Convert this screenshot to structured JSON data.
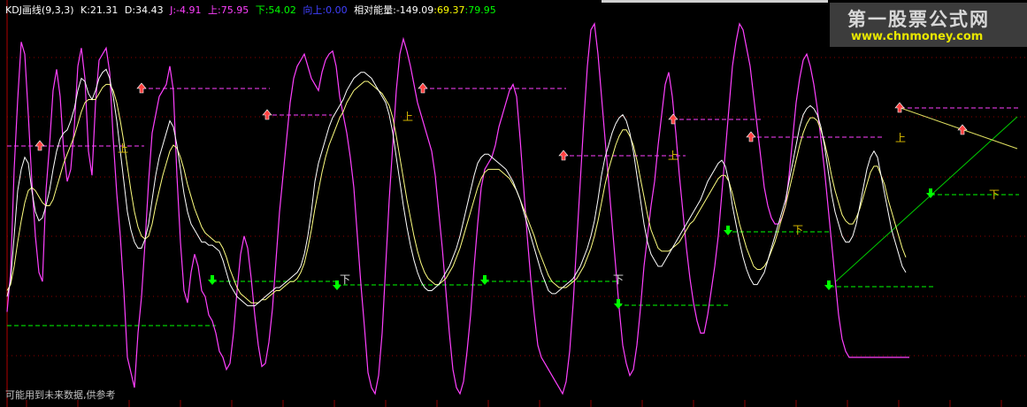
{
  "header": {
    "indicator": "KDJ画线(9,3,3)",
    "k": "K:21.31",
    "d": "D:34.43",
    "j": "J:-4.91",
    "up": "上:75.95",
    "down": "下:54.02",
    "upward": "向上:0.00",
    "energy": "相对能量:-149.09",
    "e2": ":69.37",
    "e3": ":79.95"
  },
  "footer_note": "可能用到未来数据,供参考",
  "watermark": {
    "cn": "第一股票公式网",
    "url": "www.chnmoney.com"
  },
  "colors": {
    "k": "#ffffff",
    "d": "#ffff80",
    "j": "#ff40ff",
    "up_marker": "#ff4040",
    "down_marker": "#00ff00",
    "up_line": "#ff40ff",
    "down_line": "#00ff00",
    "header_k": "#ffffff",
    "header_j": "#ff40ff",
    "header_up": "#ff40ff",
    "header_down": "#00ff00",
    "header_upward": "#4040ff",
    "header_energy": "#ffffff",
    "header_e2": "#ffff00",
    "header_e3": "#00ff00"
  },
  "chart_data": {
    "type": "line",
    "ylim": [
      -12,
      112
    ],
    "x": [
      0,
      4,
      8,
      12,
      16,
      20,
      24,
      28,
      32,
      36,
      40,
      44,
      48,
      52,
      56,
      60,
      64,
      68,
      72,
      76,
      80,
      84,
      88,
      92,
      96,
      100,
      104,
      108,
      112,
      116,
      120,
      124,
      128,
      132,
      136,
      140,
      144,
      148,
      152,
      156,
      160,
      164,
      168,
      172,
      176,
      180,
      184,
      188,
      192,
      196,
      200,
      204,
      208,
      212,
      216,
      220,
      224,
      228,
      232,
      236,
      240,
      244,
      248,
      252,
      256,
      260,
      264,
      268,
      272,
      276,
      280,
      284,
      288,
      292,
      296,
      300,
      304,
      308,
      312,
      316,
      320,
      324,
      328,
      332,
      336,
      340,
      344,
      348,
      352,
      356,
      360,
      364,
      368,
      372,
      376,
      380,
      384,
      388,
      392,
      396,
      400,
      404,
      408,
      412,
      416,
      420,
      424,
      428,
      432,
      436,
      440,
      444,
      448,
      452,
      456,
      460,
      464,
      468,
      472,
      476,
      480,
      484,
      488,
      492,
      496,
      500,
      504,
      508,
      512,
      516,
      520,
      524,
      528,
      532,
      536,
      540,
      544,
      548,
      552,
      556,
      560,
      564,
      568,
      572,
      576,
      580,
      584,
      588,
      592,
      596,
      600,
      604,
      608,
      612,
      616,
      620,
      624,
      628,
      632,
      636,
      640,
      644,
      648,
      652,
      656,
      660,
      664,
      668,
      672,
      676,
      680,
      684,
      688,
      692,
      696,
      700,
      704,
      708,
      712,
      716,
      720,
      724,
      728,
      732,
      736,
      740,
      744,
      748,
      752,
      756,
      760,
      764,
      768,
      772,
      776,
      780,
      784,
      788,
      792,
      796,
      800,
      804,
      808,
      812,
      816,
      820,
      824,
      828,
      832,
      836,
      840,
      844,
      848,
      852,
      856,
      860,
      864,
      868,
      872,
      876,
      880,
      884,
      888,
      892,
      896,
      900,
      904,
      908,
      912,
      916,
      920,
      924,
      928,
      932,
      936,
      940,
      944,
      948,
      952,
      956,
      960,
      964,
      968,
      972,
      976,
      980,
      984,
      988,
      992,
      996,
      1000,
      1004,
      1008,
      1012,
      1016,
      1020,
      1024,
      1028,
      1032,
      1036,
      1040,
      1044,
      1048,
      1052,
      1056,
      1060,
      1064,
      1068,
      1072,
      1076,
      1080,
      1084,
      1088,
      1092,
      1096,
      1100,
      1104,
      1108,
      1112,
      1116,
      1120,
      1124,
      1128,
      1132,
      1136,
      1140,
      1144,
      1148
    ],
    "series": [
      {
        "key": "k",
        "values": [
          20,
          25,
          40,
          55,
          62,
          66,
          64,
          55,
          48,
          45,
          46,
          50,
          55,
          62,
          68,
          72,
          74,
          75,
          78,
          82,
          88,
          92,
          91,
          87,
          85,
          88,
          92,
          94,
          95,
          92,
          86,
          78,
          68,
          58,
          48,
          42,
          38,
          36,
          36,
          39,
          44,
          52,
          60,
          66,
          70,
          74,
          78,
          76,
          70,
          62,
          54,
          48,
          44,
          42,
          40,
          38,
          38,
          37,
          37,
          36,
          35,
          32,
          28,
          24,
          22,
          20,
          19,
          18,
          17,
          17,
          17,
          18,
          19,
          20,
          21,
          22,
          23,
          23,
          24,
          25,
          26,
          27,
          28,
          30,
          34,
          40,
          48,
          58,
          64,
          68,
          72,
          76,
          79,
          81,
          83,
          85,
          88,
          90,
          92,
          93,
          94,
          94,
          93,
          92,
          90,
          88,
          86,
          84,
          80,
          74,
          66,
          58,
          50,
          43,
          37,
          32,
          28,
          25,
          23,
          22,
          22,
          23,
          24,
          26,
          28,
          30,
          33,
          36,
          40,
          45,
          50,
          55,
          60,
          64,
          66,
          67,
          67,
          66,
          65,
          64,
          63,
          62,
          60,
          58,
          55,
          52,
          48,
          44,
          40,
          36,
          32,
          28,
          25,
          22,
          21,
          21,
          22,
          23,
          24,
          25,
          26,
          28,
          30,
          33,
          36,
          40,
          45,
          52,
          60,
          66,
          70,
          74,
          77,
          79,
          80,
          78,
          74,
          68,
          60,
          52,
          44,
          38,
          34,
          32,
          30,
          30,
          32,
          34,
          36,
          38,
          40,
          42,
          44,
          46,
          48,
          50,
          52,
          55,
          58,
          60,
          62,
          64,
          65,
          63,
          58,
          50,
          44,
          38,
          33,
          29,
          26,
          24,
          24,
          26,
          28,
          32,
          36,
          40,
          44,
          48,
          52,
          58,
          64,
          70,
          76,
          80,
          82,
          83,
          82,
          80,
          76,
          70,
          62,
          54,
          48,
          44,
          40,
          38,
          38,
          40,
          44,
          50,
          56,
          62,
          66,
          68,
          66,
          60,
          54,
          48,
          42,
          38,
          34,
          30,
          28
        ],
        "d_values": [
          22,
          24,
          30,
          38,
          45,
          51,
          55,
          56,
          55,
          53,
          51,
          50,
          50,
          52,
          56,
          60,
          64,
          67,
          70,
          73,
          77,
          81,
          84,
          85,
          85,
          85,
          87,
          89,
          90,
          90,
          88,
          84,
          78,
          71,
          63,
          55,
          48,
          43,
          40,
          39,
          40,
          44,
          50,
          55,
          60,
          64,
          68,
          70,
          69,
          66,
          62,
          57,
          53,
          49,
          46,
          43,
          41,
          40,
          39,
          38,
          38,
          36,
          33,
          29,
          26,
          23,
          21,
          20,
          19,
          18,
          18,
          18,
          19,
          19,
          20,
          21,
          22,
          22,
          23,
          24,
          25,
          25,
          26,
          28,
          31,
          36,
          42,
          49,
          55,
          61,
          66,
          70,
          73,
          76,
          79,
          81,
          84,
          86,
          88,
          89,
          90,
          91,
          91,
          90,
          89,
          88,
          87,
          85,
          83,
          79,
          73,
          66,
          59,
          52,
          46,
          40,
          35,
          31,
          28,
          26,
          25,
          24,
          24,
          25,
          26,
          28,
          30,
          33,
          36,
          40,
          44,
          48,
          52,
          56,
          59,
          61,
          62,
          62,
          62,
          62,
          61,
          60,
          59,
          57,
          55,
          52,
          49,
          46,
          43,
          40,
          36,
          33,
          30,
          27,
          25,
          24,
          23,
          23,
          23,
          24,
          25,
          26,
          28,
          30,
          33,
          36,
          40,
          45,
          51,
          57,
          62,
          66,
          70,
          73,
          75,
          75,
          73,
          70,
          65,
          59,
          53,
          47,
          42,
          39,
          36,
          35,
          35,
          35,
          36,
          37,
          38,
          40,
          42,
          44,
          45,
          47,
          49,
          51,
          53,
          55,
          57,
          59,
          60,
          60,
          58,
          54,
          49,
          44,
          40,
          36,
          33,
          30,
          29,
          29,
          30,
          32,
          35,
          38,
          42,
          46,
          50,
          55,
          60,
          65,
          70,
          74,
          77,
          79,
          79,
          78,
          75,
          71,
          66,
          60,
          55,
          51,
          47,
          45,
          44,
          44,
          46,
          49,
          53,
          57,
          61,
          63,
          63,
          60,
          57,
          52,
          48,
          44,
          40,
          36,
          33
        ],
        "j_values": [
          15,
          28,
          62,
          85,
          104,
          100,
          80,
          58,
          40,
          28,
          25,
          55,
          70,
          88,
          95,
          86,
          68,
          58,
          62,
          76,
          96,
          102,
          92,
          68,
          60,
          84,
          98,
          100,
          102,
          94,
          72,
          54,
          40,
          22,
          0,
          -5,
          -10,
          8,
          20,
          38,
          58,
          74,
          80,
          86,
          88,
          90,
          96,
          88,
          60,
          38,
          22,
          18,
          28,
          34,
          30,
          22,
          20,
          14,
          12,
          8,
          2,
          0,
          -4,
          -2,
          8,
          22,
          34,
          40,
          36,
          26,
          14,
          4,
          -3,
          -2,
          5,
          16,
          32,
          48,
          60,
          72,
          84,
          92,
          96,
          98,
          100,
          96,
          92,
          90,
          88,
          94,
          98,
          100,
          101,
          96,
          86,
          80,
          74,
          66,
          56,
          40,
          24,
          10,
          -5,
          -10,
          -12,
          -6,
          8,
          30,
          52,
          70,
          88,
          100,
          105,
          101,
          96,
          90,
          84,
          80,
          76,
          72,
          68,
          60,
          48,
          36,
          22,
          8,
          -4,
          -10,
          -12,
          -8,
          2,
          14,
          30,
          44,
          56,
          62,
          64,
          66,
          70,
          76,
          80,
          84,
          88,
          90,
          86,
          72,
          56,
          40,
          26,
          14,
          4,
          0,
          -2,
          -4,
          -6,
          -8,
          -10,
          -12,
          -8,
          2,
          18,
          38,
          58,
          78,
          96,
          108,
          110,
          100,
          86,
          72,
          58,
          44,
          30,
          16,
          4,
          -2,
          -6,
          -4,
          4,
          16,
          30,
          40,
          50,
          58,
          70,
          80,
          90,
          94,
          86,
          74,
          60,
          48,
          36,
          26,
          18,
          12,
          8,
          8,
          14,
          22,
          30,
          40,
          54,
          68,
          82,
          96,
          104,
          110,
          108,
          102,
          96,
          86,
          76,
          66,
          56,
          50,
          46,
          44,
          44,
          46,
          50,
          60,
          72,
          84,
          92,
          98,
          100,
          96,
          90,
          82,
          72,
          62,
          50,
          38,
          26,
          14,
          6,
          2,
          0,
          0,
          0,
          0,
          0,
          0,
          0,
          0,
          0,
          0,
          0,
          0,
          0,
          0,
          0,
          0,
          0,
          0
        ]
      }
    ]
  }
}
